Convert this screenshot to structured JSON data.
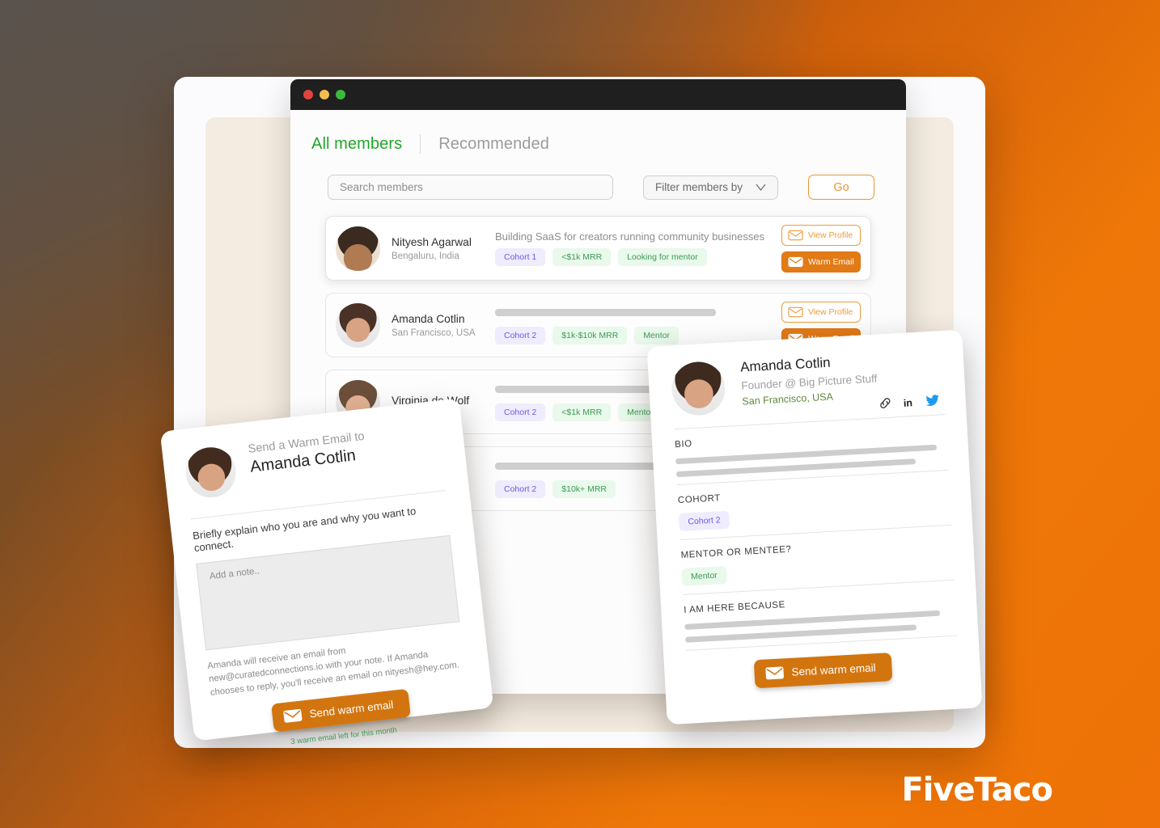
{
  "brand": {
    "logo": "FiveTaco"
  },
  "window": {
    "traffic_lights": [
      "close",
      "minimize",
      "maximize"
    ]
  },
  "tabs": [
    {
      "label": "All members",
      "active": true
    },
    {
      "label": "Recommended",
      "active": false
    }
  ],
  "search": {
    "placeholder": "Search members",
    "value": "",
    "filter_label": "Filter members by",
    "go_label": "Go"
  },
  "row_actions": {
    "view_profile": "View Profile",
    "warm_email": "Warm Email"
  },
  "members": [
    {
      "name": "Nityesh Agarwal",
      "location": "Bengaluru, India",
      "headline": "Building SaaS for creators running community businesses",
      "tags": [
        "Cohort 1",
        "<$1k MRR",
        "Looking for mentor"
      ],
      "featured": true
    },
    {
      "name": "Amanda Cotlin",
      "location": "San Francisco, USA",
      "headline": "",
      "tags": [
        "Cohort 2",
        "$1k-$10k MRR",
        "Mentor"
      ],
      "featured": false
    },
    {
      "name": "Virginia de Wolf",
      "location": "",
      "headline": "",
      "tags": [
        "Cohort 2",
        "<$1k MRR",
        "Mentor"
      ],
      "featured": false
    },
    {
      "name": "",
      "location": "",
      "headline": "",
      "tags": [
        "Cohort 2",
        "$10k+ MRR"
      ],
      "featured": false
    }
  ],
  "warm_email_card": {
    "eyebrow": "Send a Warm Email to",
    "recipient": "Amanda Cotlin",
    "prompt": "Briefly explain who you are and why you want to connect.",
    "note_placeholder": "Add a note..",
    "note_value": "",
    "disclaimer": "Amanda will receive an email from new@curatedconnections.io with your note. If Amanda chooses to reply, you'll receive an email on nityesh@hey.com.",
    "send_label": "Send warm email",
    "quota": "3 warm email left for this month"
  },
  "profile_card": {
    "name": "Amanda Cotlin",
    "role": "Founder @ Big Picture Stuff",
    "location": "San Francisco, USA",
    "social": [
      "link-icon",
      "linkedin-icon",
      "twitter-icon"
    ],
    "sections": [
      {
        "label": "BIO",
        "type": "skeleton",
        "lines": 2
      },
      {
        "label": "COHORT",
        "type": "tag",
        "tag": "Cohort 2",
        "tag_color": "purple"
      },
      {
        "label": "MENTOR OR MENTEE?",
        "type": "tag",
        "tag": "Mentor",
        "tag_color": "green"
      },
      {
        "label": "I AM HERE BECAUSE",
        "type": "skeleton",
        "lines": 2
      }
    ],
    "send_label": "Send warm email"
  },
  "colors": {
    "accent_orange": "#e27a16",
    "accent_orange_light": "#ef9a3a",
    "green": "#21a52a",
    "tag_purple_bg": "#efecfe",
    "tag_purple_fg": "#6b5ce0",
    "tag_green_bg": "#e9f9ec",
    "tag_green_fg": "#3f9a56",
    "background_orange": "#ee7207",
    "background_dark": "#5b524b",
    "cream_panel": "#f4ece1"
  }
}
